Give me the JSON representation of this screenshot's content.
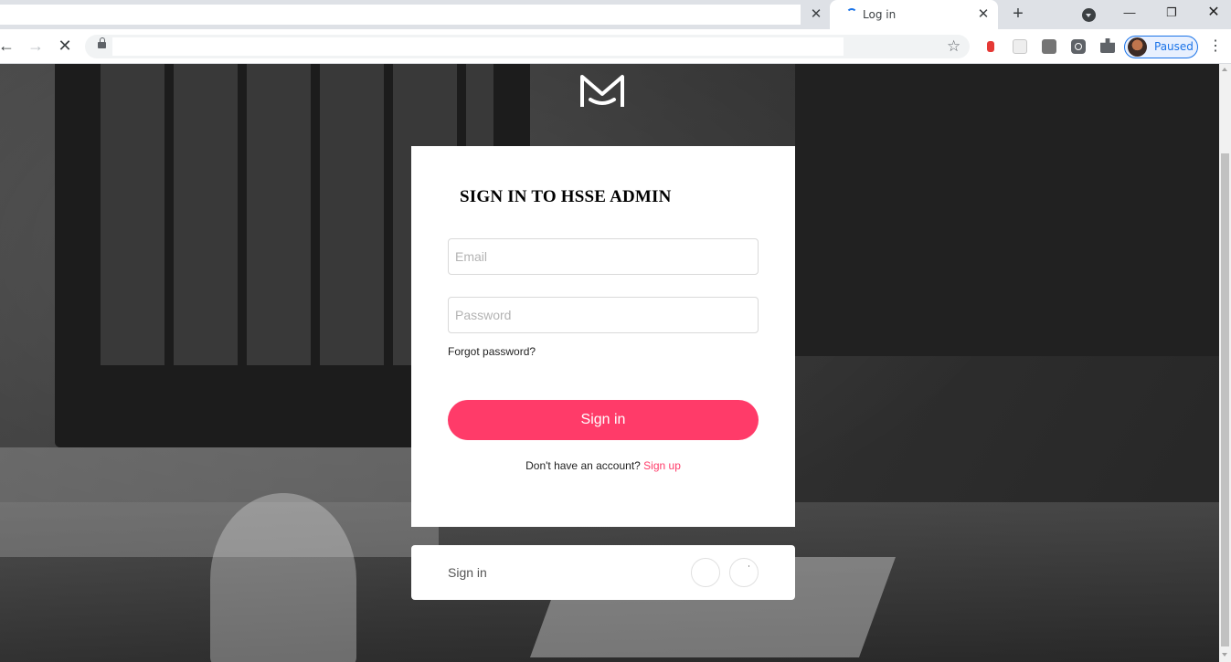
{
  "browser": {
    "active_tab": {
      "title": "Log in"
    },
    "profile": {
      "status": "Paused"
    },
    "accent_color": "#1a73e8"
  },
  "page": {
    "title": "SIGN IN TO HSSE ADMIN",
    "email": {
      "placeholder": "Email",
      "value": ""
    },
    "password": {
      "placeholder": "Password",
      "value": ""
    },
    "forgot_password": "Forgot password?",
    "signin_button": "Sign in",
    "signup_prompt": "Don't have an account?",
    "signup_link": "Sign up",
    "footer_label": "Sign in",
    "accent_color": "#ff3b69"
  },
  "icons": {
    "back": "arrow-left-icon",
    "forward": "arrow-right-icon",
    "stop": "close-icon",
    "bookmark": "star-icon",
    "extensions": "puzzle-icon",
    "menu": "more-vertical-icon"
  }
}
